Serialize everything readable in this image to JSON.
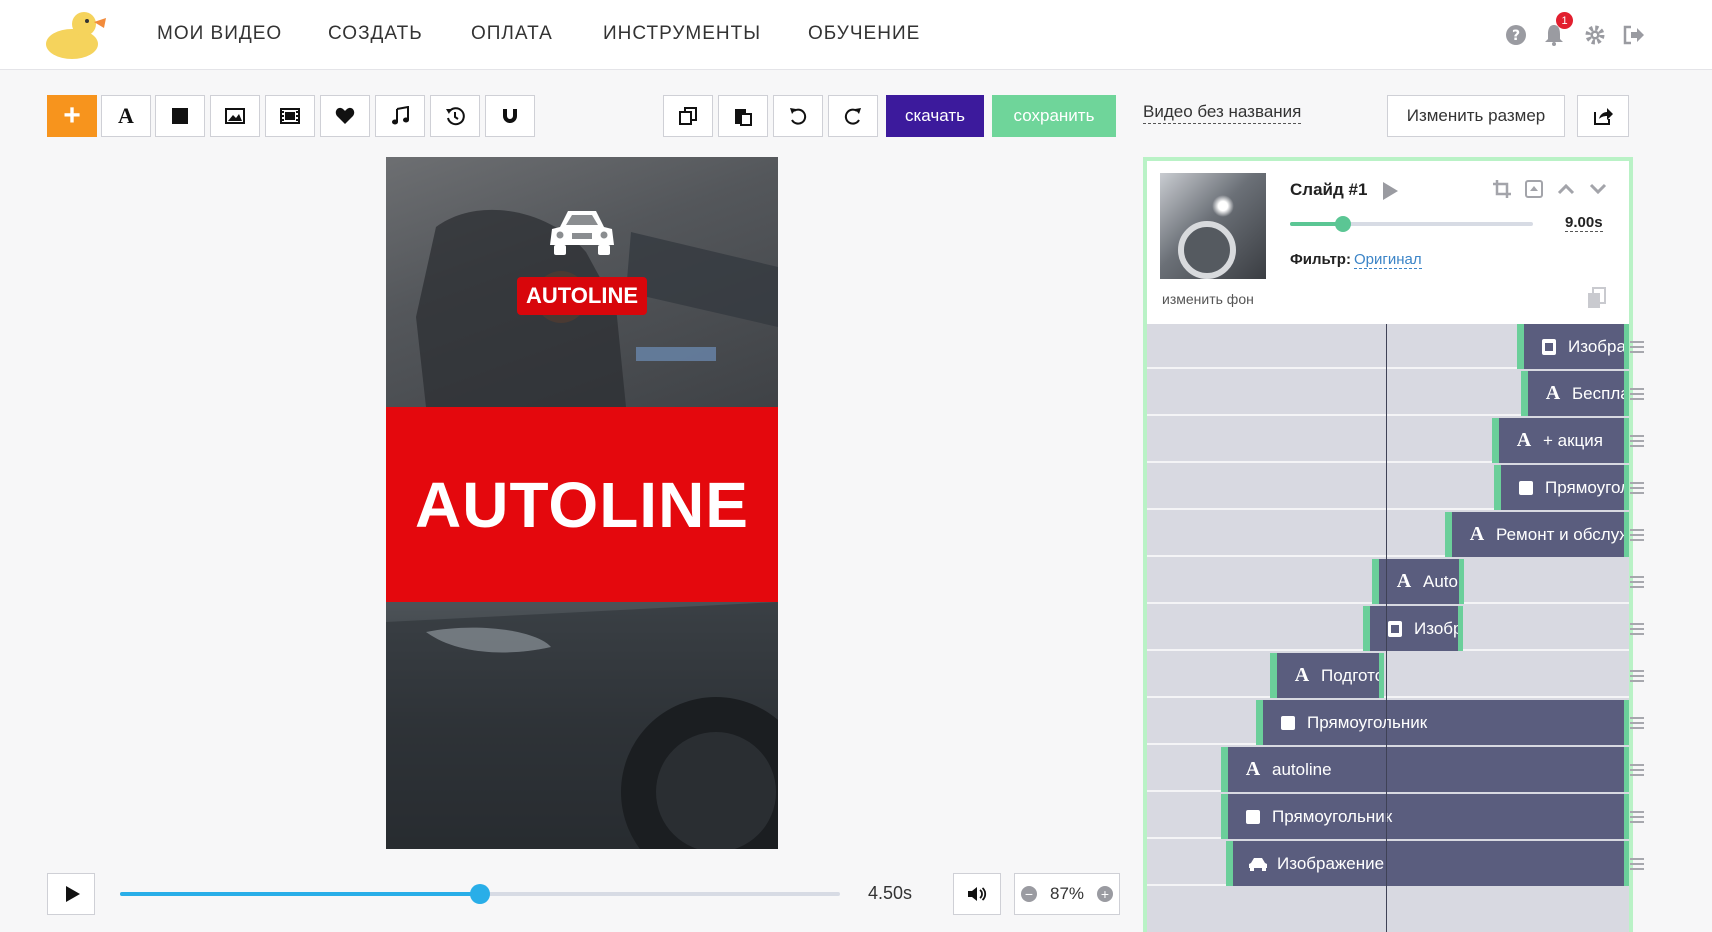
{
  "nav": {
    "items": [
      "МОИ ВИДЕО",
      "СОЗДАТЬ",
      "ОПЛАТА",
      "ИНСТРУМЕНТЫ",
      "ОБУЧЕНИЕ"
    ],
    "notifications_count": "1"
  },
  "toolbar": {
    "download_label": "скачать",
    "save_label": "сохранить",
    "text_tool_glyph": "A"
  },
  "project": {
    "video_name": "Видео без названия",
    "resize_label": "Изменить размер"
  },
  "preview": {
    "badge_text": "AUTOLINE",
    "title_text": "AUTOLINE",
    "colors": {
      "red_band": "#e4080d",
      "badge": "#d8060b"
    }
  },
  "playback": {
    "time": "4.50s",
    "progress": 0.5,
    "zoom": "87%"
  },
  "slide": {
    "title": "Слайд #1",
    "duration": "9.00s",
    "duration_progress": 0.22,
    "filter_label": "Фильтр:",
    "filter_value": "Оригинал",
    "change_bg_label": "изменить фон"
  },
  "timeline": {
    "layers": [
      {
        "icon": "image-icon",
        "label": "Изображение"
      },
      {
        "icon": "text-icon",
        "label": "Бесплатная диагностика"
      },
      {
        "icon": "text-icon",
        "label": "+ акция"
      },
      {
        "icon": "rect-icon",
        "label": "Прямоугольник"
      },
      {
        "icon": "text-icon",
        "label": "Ремонт и обслуживание"
      },
      {
        "icon": "text-icon",
        "label": "Autoline"
      },
      {
        "icon": "image-icon",
        "label": "Изображение"
      },
      {
        "icon": "text-icon",
        "label": "Подготовка"
      },
      {
        "icon": "rect-icon",
        "label": "Прямоугольник"
      },
      {
        "icon": "text-icon",
        "label": "autoline"
      },
      {
        "icon": "rect-icon",
        "label": "Прямоугольник"
      },
      {
        "icon": "car-icon",
        "label": "Изображение"
      }
    ]
  }
}
